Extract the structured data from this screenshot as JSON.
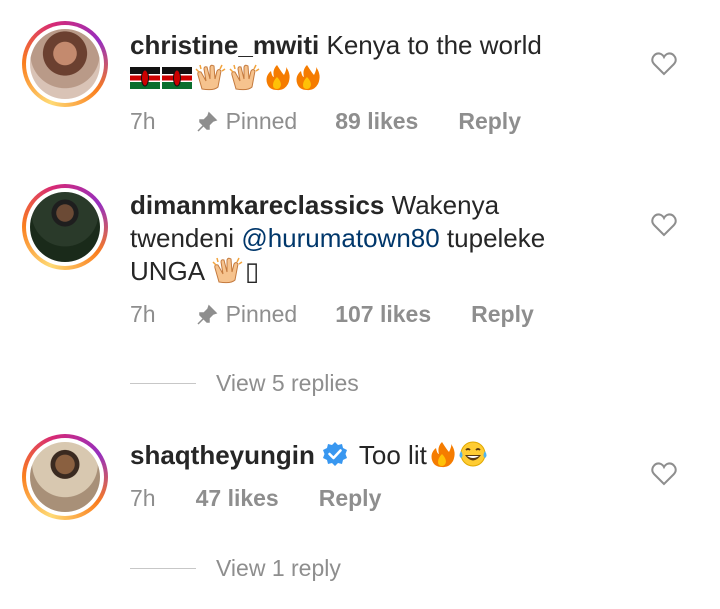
{
  "comments": [
    {
      "username": "christine_mwiti",
      "text": " Kenya to the world",
      "emoji_line": [
        "kenya-flag",
        "kenya-flag",
        "clapping-hands",
        "clapping-hands",
        "fire",
        "fire"
      ],
      "time": "7h",
      "pinned_label": "Pinned",
      "likes": "89 likes",
      "reply_label": "Reply"
    },
    {
      "username": "dimanmkareclassics",
      "text_part1": " Wakenya",
      "text_part2": "twendeni ",
      "mention": "@hurumatown80",
      "text_part3": "  tupeleke",
      "text_part4": "UNGA ",
      "trailing_glyph": "▯",
      "time": "7h",
      "pinned_label": "Pinned",
      "likes": "107 likes",
      "reply_label": "Reply",
      "view_replies": "View 5 replies"
    },
    {
      "username": "shaqtheyungin",
      "verified": true,
      "text": "Too lit",
      "emojis": [
        "fire",
        "tears-of-joy"
      ],
      "time": "7h",
      "likes": "47 likes",
      "reply_label": "Reply",
      "view_replies": "View 1 reply"
    }
  ],
  "colors": {
    "text": "#262626",
    "meta": "#8e8e8e",
    "mention": "#00376b",
    "verified": "#3897f0"
  }
}
